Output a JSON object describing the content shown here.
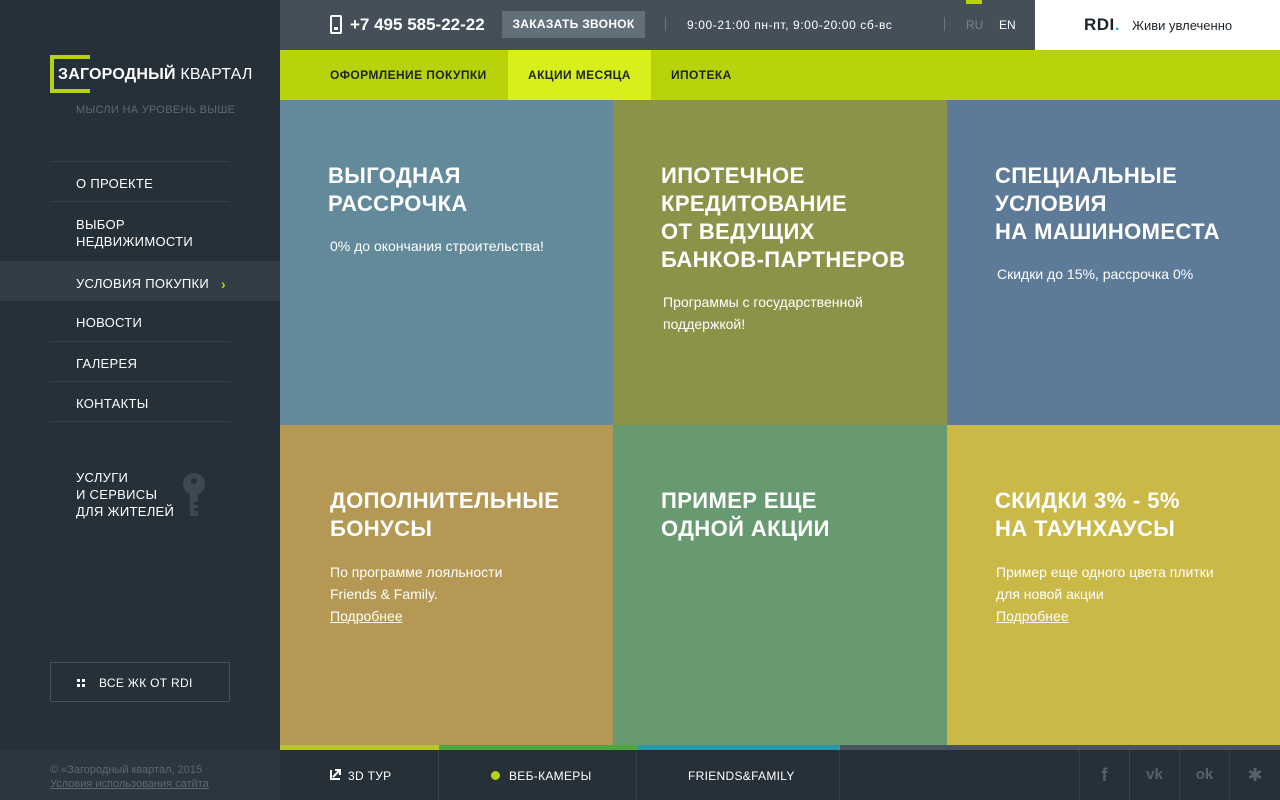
{
  "brand": {
    "logo_bold": "ЗАГОРОДНЫЙ",
    "logo_regular": "КВАРТАЛ",
    "tagline": "МЫСЛИ НА УРОВЕНЬ ВЫШЕ"
  },
  "sidebar": {
    "items": [
      {
        "label": "О ПРОЕКТЕ"
      },
      {
        "label": "ВЫБОР\nНЕДВИЖИМОСТИ"
      },
      {
        "label": "УСЛОВИЯ ПОКУПКИ",
        "active": true
      },
      {
        "label": "НОВОСТИ"
      },
      {
        "label": "ГАЛЕРЕЯ"
      },
      {
        "label": "КОНТАКТЫ"
      }
    ],
    "services": "УСЛУГИ\nИ СЕРВИСЫ\nДЛЯ ЖИТЕЛЕЙ",
    "services_icon": "key-icon",
    "all_button": "ВСЕ ЖК ОТ RDI",
    "copyright": "© «Загородный квартал, 2015",
    "terms_link": "Условия использования сатйта"
  },
  "topbar": {
    "phone": "+7 495 585-22-22",
    "callback": "ЗАКАЗАТЬ ЗВОНОК",
    "hours": "9:00-21:00 пн-пт, 9:00-20:00 сб-вс",
    "lang_ru": "RU",
    "lang_en": "EN",
    "rdi": "RDI",
    "rdi_dot": ".",
    "slogan": "Живи увлеченно"
  },
  "subnav": {
    "items": [
      "ОФОРМЛЕНИЕ ПОКУПКИ",
      "АКЦИИ МЕСЯЦА",
      "ИПОТЕКА"
    ],
    "active_index": 1
  },
  "tiles": [
    {
      "title": "ВЫГОДНАЯ\nРАССРОЧКА",
      "text": "0% до окончания строительства!",
      "color": "#628a9a"
    },
    {
      "title": "ИПОТЕЧНОЕ\nКРЕДИТОВАНИЕ\nОТ ВЕДУЩИХ\nБАНКОВ-ПАРТНЕРОВ",
      "text": "Программы с государственной\nподдержкой!",
      "color": "#8a9347"
    },
    {
      "title": "СПЕЦИАЛЬНЫЕ\nУСЛОВИЯ\nНА МАШИНОМЕСТА",
      "text": "Скидки до 15%, рассрочка 0%",
      "color": "#5d7b98"
    },
    {
      "title": "ДОПОЛНИТЕЛЬНЫЕ\nБОНУСЫ",
      "text": "По программе лояльности\nFriends & Family.",
      "link": "Подробнее",
      "color": "#b59853"
    },
    {
      "title": "ПРИМЕР ЕЩЕ\nОДНОЙ АКЦИИ",
      "text": "",
      "color": "#679a70"
    },
    {
      "title": "СКИДКИ 3% - 5%\nНА ТАУНХАУСЫ",
      "text": "Пример еще одного цвета плитки\nдля новой акции",
      "link": "Подробнее",
      "color": "#cab847"
    }
  ],
  "bottombar": {
    "tour": "3D ТУР",
    "webcams": "ВЕБ-КАМЕРЫ",
    "friends": "FRIENDS&FAMILY",
    "strip_colors": [
      "#b8c52e",
      "#4ea63e",
      "#2b9aa8",
      "#4a545c"
    ]
  },
  "social": [
    {
      "icon": "facebook-icon",
      "glyph": "f"
    },
    {
      "icon": "vk-icon",
      "glyph": "vk"
    },
    {
      "icon": "odnoklassniki-icon",
      "glyph": "ok"
    },
    {
      "icon": "ant-icon",
      "glyph": "✱"
    }
  ],
  "colors": {
    "accent": "#b8d20c",
    "accent_light": "#d8ef1b",
    "sidebar_bg": "#263038",
    "topbar_bg": "#444f5a"
  }
}
